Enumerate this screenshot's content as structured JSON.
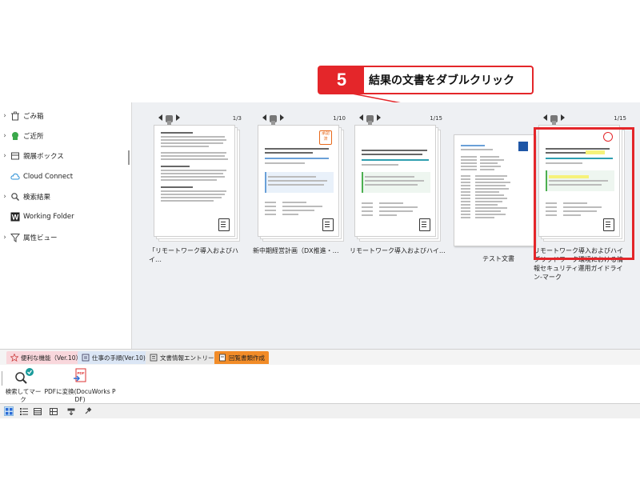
{
  "callout": {
    "step": "5",
    "text": "結果の文書をダブルクリック"
  },
  "sidebar": {
    "items": [
      {
        "label": "ごみ箱",
        "icon": "trash-icon"
      },
      {
        "label": "ご近所",
        "icon": "neighbors-icon"
      },
      {
        "label": "親展ボックス",
        "icon": "confidential-box-icon"
      },
      {
        "label": "Cloud Connect",
        "icon": "cloud-icon"
      },
      {
        "label": "検索結果",
        "icon": "search-icon"
      },
      {
        "label": "Working Folder",
        "icon": "working-folder-icon"
      },
      {
        "label": "属性ビュー",
        "icon": "filter-icon"
      }
    ]
  },
  "documents": [
    {
      "name": "「リモートワーク導入およびハイ…",
      "page": "1/3"
    },
    {
      "name": "新中期経営計画（DX推進・…",
      "page": "1/10",
      "stamp": "承認済"
    },
    {
      "name": "リモートワーク導入およびハイ…",
      "page": "1/15"
    },
    {
      "name": "テスト文書",
      "page": ""
    },
    {
      "name": "リモートワーク導入およびハイブリッドワーク環境における情報セキュリティ運用ガイドライン-マーク",
      "page": "1/15",
      "selected": true
    }
  ],
  "tabs": [
    {
      "label": "便利な機能（Ver.10）",
      "icon": "star-icon",
      "color": "#f9d7dc"
    },
    {
      "label": "仕事の手順(Ver.10)",
      "icon": "procedure-icon",
      "color": "#dbe6f5"
    },
    {
      "label": "文書情報エントリー",
      "icon": "entry-icon",
      "color": "#e8e8e8"
    },
    {
      "label": "回覧書類作成",
      "icon": "circulation-icon",
      "color": "#f28c28",
      "active": true
    }
  ],
  "ribbon": {
    "buttons": [
      {
        "label": "検索してマーク",
        "icon": "search-mark-icon"
      },
      {
        "label": "PDFに変換(DocuWorks PDF)",
        "label_line1": "PDFに変換(DocuWorks P",
        "label_line2": "DF)",
        "icon": "pdf-convert-icon"
      }
    ]
  },
  "colors": {
    "accent_red": "#e4262a",
    "active_tab": "#f28c28",
    "link_blue": "#1e73be"
  }
}
